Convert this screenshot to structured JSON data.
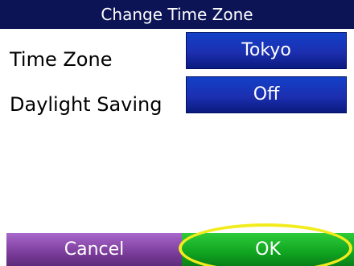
{
  "header": {
    "title": "Change Time Zone"
  },
  "rows": [
    {
      "label": "Time Zone",
      "value": "Tokyo"
    },
    {
      "label": "Daylight Saving",
      "value": "Off"
    }
  ],
  "footer": {
    "cancel_label": "Cancel",
    "ok_label": "OK"
  },
  "colors": {
    "title_bg": "#0c1456",
    "value_button": "#1c2fb0",
    "cancel_button": "#7b3c9b",
    "ok_button": "#10a420",
    "highlight": "#f2ec1c"
  }
}
